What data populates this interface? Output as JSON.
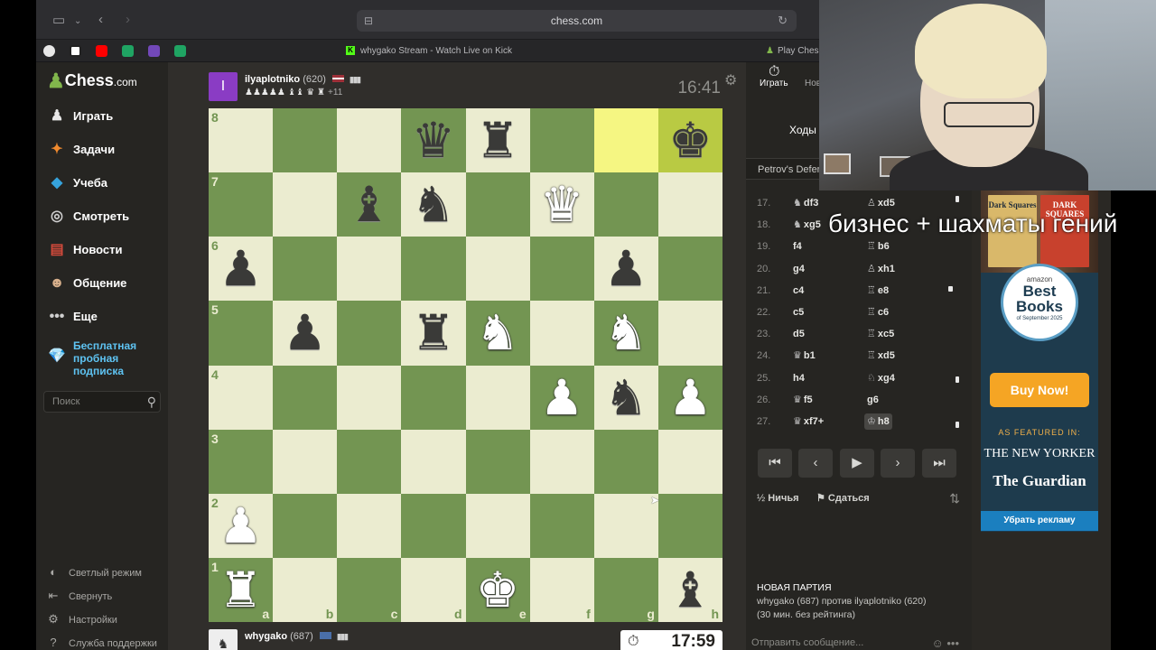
{
  "browser": {
    "url": "chess.com",
    "tabs": [
      {
        "label": "whygako Stream - Watch Live on Kick"
      },
      {
        "label": "Play Chess"
      }
    ],
    "bookmark_icons": [
      "chatgpt-icon",
      "notion-icon",
      "youtube-icon",
      "sheets-icon",
      "forms-icon",
      "sheets-icon"
    ]
  },
  "sidebar": {
    "logo_text": "Chess",
    "logo_suffix": ".com",
    "items": [
      {
        "label": "Играть",
        "icon": "play-icon"
      },
      {
        "label": "Задачи",
        "icon": "puzzle-icon"
      },
      {
        "label": "Учеба",
        "icon": "learn-icon"
      },
      {
        "label": "Смотреть",
        "icon": "watch-icon"
      },
      {
        "label": "Новости",
        "icon": "news-icon"
      },
      {
        "label": "Общение",
        "icon": "social-icon"
      },
      {
        "label": "Еще",
        "icon": "more-icon"
      }
    ],
    "trial_label": "Бесплатная пробная подписка",
    "search_placeholder": "Поиск",
    "bottom": [
      {
        "label": "Светлый режим",
        "icon": "theme-icon"
      },
      {
        "label": "Свернуть",
        "icon": "collapse-icon"
      },
      {
        "label": "Настройки",
        "icon": "settings-icon"
      },
      {
        "label": "Служба поддержки",
        "icon": "support-icon"
      }
    ]
  },
  "top_player": {
    "avatar_letter": "I",
    "name": "ilyaplotniko",
    "rating": "(620)",
    "captured": "♟♟♟♟♟ ♝♝ ♛ ♜",
    "advantage": "+11",
    "clock": "16:41"
  },
  "bottom_player": {
    "name": "whygako",
    "rating": "(687)",
    "clock": "17:59"
  },
  "board": {
    "ranks": [
      "8",
      "7",
      "6",
      "5",
      "4",
      "3",
      "2",
      "1"
    ],
    "files": [
      "a",
      "b",
      "c",
      "d",
      "e",
      "f",
      "g",
      "h"
    ],
    "highlight": [
      "g8",
      "h8"
    ],
    "pieces": {
      "d8": "♛",
      "e8": "♜",
      "h8": "♚",
      "c7": "♝",
      "d7": "♞",
      "f7": "♕",
      "a6": "♟",
      "g6": "♟",
      "b5": "♟",
      "d5": "♜",
      "e5": "♘",
      "g5": "♘",
      "f4": "♙",
      "g4": "♞",
      "h4": "♙",
      "a2": "♙",
      "a1": "♖",
      "e1": "♔",
      "h1": "♝"
    },
    "colors": {
      "light": "#ebecd0",
      "dark": "#739552",
      "highlight_light": "#f5f682",
      "highlight_dark": "#b9ca43"
    }
  },
  "panel": {
    "tab_play": "Играть",
    "tab_new": "Нов",
    "moves_tab": "Ходы",
    "opening": "Petrov's Defen",
    "moves": [
      {
        "n": "17.",
        "w": "df3",
        "wp": "♞",
        "b": "xd5",
        "bp": "♙"
      },
      {
        "n": "18.",
        "w": "xg5",
        "wp": "♞",
        "b": "",
        "bp": ""
      },
      {
        "n": "19.",
        "w": "f4",
        "wp": "",
        "b": "b6",
        "bp": "♖"
      },
      {
        "n": "20.",
        "w": "g4",
        "wp": "",
        "b": "xh1",
        "bp": "♙"
      },
      {
        "n": "21.",
        "w": "c4",
        "wp": "",
        "b": "e8",
        "bp": "♖"
      },
      {
        "n": "22.",
        "w": "c5",
        "wp": "",
        "b": "c6",
        "bp": "♖"
      },
      {
        "n": "23.",
        "w": "d5",
        "wp": "",
        "b": "xc5",
        "bp": "♖"
      },
      {
        "n": "24.",
        "w": "b1",
        "wp": "♛",
        "b": "xd5",
        "bp": "♖"
      },
      {
        "n": "25.",
        "w": "h4",
        "wp": "",
        "b": "xg4",
        "bp": "♘"
      },
      {
        "n": "26.",
        "w": "f5",
        "wp": "♛",
        "b": "g6",
        "bp": ""
      },
      {
        "n": "27.",
        "w": "xf7+",
        "wp": "♛",
        "b": "h8",
        "bp": "♔"
      }
    ],
    "draw_label": "Ничья",
    "resign_label": "Сдаться",
    "new_game_heading": "НОВАЯ ПАРТИЯ",
    "new_game_line1": "whygako (687) против ilyaplotniko (620)",
    "new_game_line2": "(30 мин. без рейтинга)",
    "message_placeholder": "Отправить сообщение..."
  },
  "ad": {
    "book1_title": "Dark Squares",
    "book2_title": "DARK SQUARES",
    "badge_top": "amazon",
    "badge_main": "Best Books",
    "badge_sub": "of September 2025",
    "buy_label": "Buy Now!",
    "featured_label": "AS FEATURED IN:",
    "outlet1": "THE NEW YORKER",
    "outlet2": "The Guardian",
    "remove_label": "Убрать рекламу"
  },
  "stream": {
    "caption": "бизнес + шахматы гений"
  }
}
